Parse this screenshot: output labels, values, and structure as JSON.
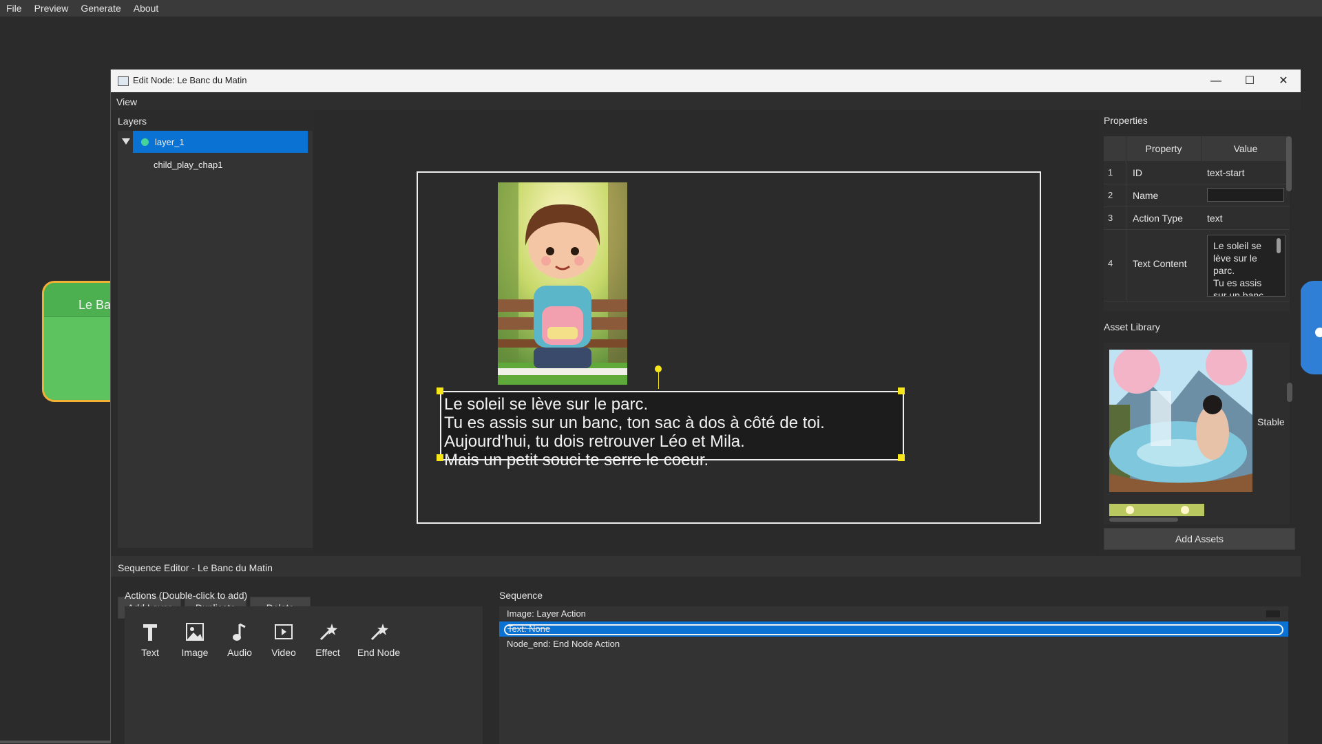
{
  "menubar": {
    "items": [
      "File",
      "Preview",
      "Generate",
      "About"
    ]
  },
  "background_node": {
    "label": "Le Ba"
  },
  "window": {
    "title": "Edit Node: Le Banc du Matin",
    "controls": {
      "minimize": "—",
      "maximize": "☐",
      "close": "✕"
    },
    "view_menu": "View"
  },
  "layers": {
    "title": "Layers",
    "items": [
      {
        "label": "layer_1",
        "selected": true,
        "expanded": true
      },
      {
        "label": "child_play_chap1",
        "selected": false
      }
    ],
    "buttons": {
      "add": "Add Layer",
      "duplicate": "Duplicate",
      "delete": "Delete"
    }
  },
  "canvas": {
    "image_asset": "child_play_chap1",
    "text_lines": [
      "Le soleil se lève sur le parc.",
      "Tu es assis sur un banc, ton sac à dos à côté de toi.",
      "Aujourd'hui, tu dois retrouver Léo et Mila.",
      "Mais un petit souci te serre le coeur."
    ],
    "handle_color": "#f7e51b"
  },
  "properties": {
    "title": "Properties",
    "columns": [
      "Property",
      "Value"
    ],
    "rows": [
      {
        "n": "1",
        "property": "ID",
        "value": "text-start"
      },
      {
        "n": "2",
        "property": "Name",
        "value": ""
      },
      {
        "n": "3",
        "property": "Action Type",
        "value": "text"
      },
      {
        "n": "4",
        "property": "Text Content",
        "value": "Le soleil se lève sur le parc.\nTu es assis sur un banc"
      }
    ]
  },
  "asset_library": {
    "title": "Asset Library",
    "items": [
      {
        "label": "Stable"
      }
    ],
    "add_button": "Add Assets"
  },
  "sequence_editor": {
    "title": "Sequence Editor - Le Banc du Matin",
    "actions_title": "Actions (Double-click to add)",
    "actions": [
      {
        "label": "Text",
        "icon": "text-icon"
      },
      {
        "label": "Image",
        "icon": "image-icon"
      },
      {
        "label": "Audio",
        "icon": "audio-icon"
      },
      {
        "label": "Video",
        "icon": "video-icon"
      },
      {
        "label": "Effect",
        "icon": "effect-icon"
      },
      {
        "label": "End Node",
        "icon": "end-node-icon"
      }
    ],
    "sequence_title": "Sequence",
    "sequence_items": [
      {
        "label": "Image: Layer Action",
        "selected": false
      },
      {
        "label": "Text: None",
        "selected": true
      },
      {
        "label": "Node_end: End Node Action",
        "selected": false
      }
    ]
  },
  "colors": {
    "accent": "#0a72d2",
    "node_green": "#5cc35e",
    "node_border": "#f2b134",
    "node_blue": "#2f7fd6"
  }
}
